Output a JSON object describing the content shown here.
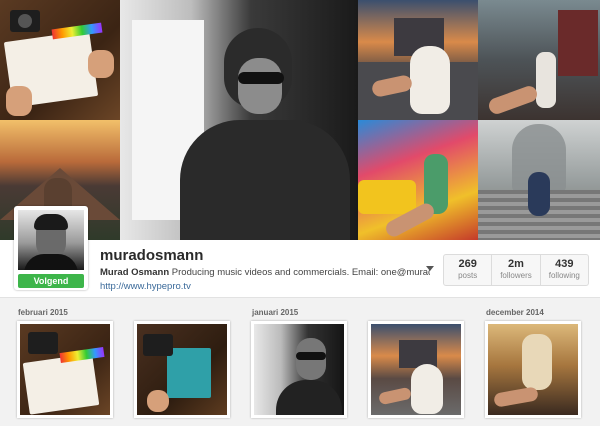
{
  "profile": {
    "username": "muradosmann",
    "full_name": "Murad Osmann",
    "bio": "Producing music videos and commercials. Email: one@muradosmann.com",
    "website": "http://www.hypepro.tv",
    "follow_label": "Volgend"
  },
  "stats": [
    {
      "value": "269",
      "label": "posts"
    },
    {
      "value": "2m",
      "label": "followers"
    },
    {
      "value": "439",
      "label": "following"
    }
  ],
  "months": {
    "m1": "februari 2015",
    "m2": "januari 2015",
    "m3": "december 2014"
  },
  "header_tiles": [
    {
      "name": "notebook-photo"
    },
    {
      "name": "mountain-photo"
    },
    {
      "name": "portrait-photo"
    },
    {
      "name": "castle-photo"
    },
    {
      "name": "city-bus-photo"
    },
    {
      "name": "taxi-photo"
    },
    {
      "name": "buddha-stairs-photo"
    }
  ],
  "colors": {
    "follow_green": "#3db54a",
    "link_blue": "#3b6a9a",
    "page_bg": "#f2f2f2"
  }
}
